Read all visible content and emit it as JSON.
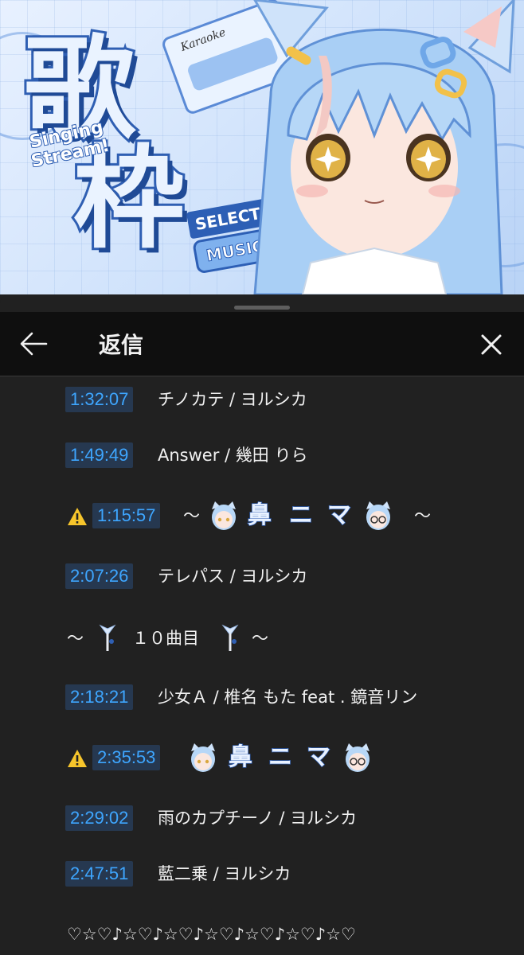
{
  "thumbnail": {
    "title_kanji_1": "歌",
    "title_kanji_2": "枠",
    "subtitle": "Singing Stream!",
    "cassette_label": "Karaoke",
    "badge_select": "SELECT",
    "badge_music": "MUSIC",
    "accent": "#2f5fb3"
  },
  "sheet": {
    "title": "返信",
    "back_icon": "arrow-left-icon",
    "close_icon": "close-icon"
  },
  "replies": {
    "row1": {
      "time": "1:32:07",
      "song": "チノカテ / ヨルシカ"
    },
    "row2": {
      "time": "1:49:49",
      "song": "Answer / 幾田 りら"
    },
    "row3": {
      "time": "1:15:57",
      "prefix": "～",
      "chars": [
        "鼻",
        "ニ",
        "マ"
      ],
      "suffix": "～"
    },
    "row4": {
      "time": "2:07:26",
      "song": "テレパス / ヨルシカ"
    },
    "row5": {
      "prefix": "～",
      "text": "１０曲目",
      "suffix": "～"
    },
    "row6": {
      "time": "2:18:21",
      "song": "少女Ａ / 椎名 もた feat . 鏡音リン"
    },
    "row7": {
      "time": "2:35:53",
      "chars": [
        "鼻",
        "ニ",
        "マ"
      ]
    },
    "row8": {
      "time": "2:29:02",
      "song": "雨のカプチーノ / ヨルシカ"
    },
    "row9": {
      "time": "2:47:51",
      "song": "藍二乗 / ヨルシカ"
    },
    "row10": {
      "text": "♡☆♡♪☆♡♪☆♡♪☆♡♪☆♡♪☆♡♪☆♡"
    }
  },
  "colors": {
    "timestamp_text": "#3ea6ff",
    "timestamp_bg": "#263850",
    "sheet_bg": "#212121",
    "header_bg": "#0f0f0f"
  }
}
